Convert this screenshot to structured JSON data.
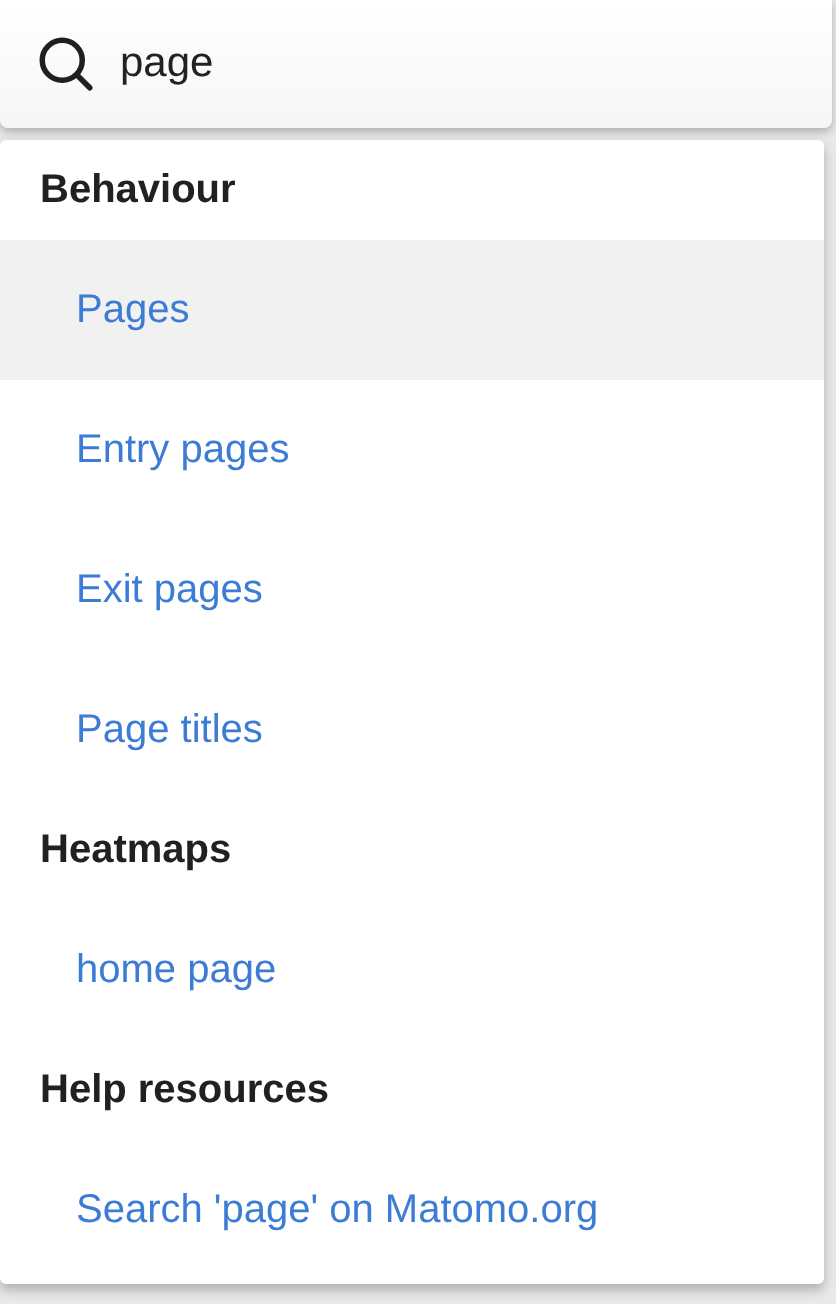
{
  "search": {
    "value": "page"
  },
  "groups": [
    {
      "heading": "Behaviour",
      "items": [
        {
          "label": "Pages",
          "selected": true
        },
        {
          "label": "Entry pages",
          "selected": false
        },
        {
          "label": "Exit pages",
          "selected": false
        },
        {
          "label": "Page titles",
          "selected": false
        }
      ]
    },
    {
      "heading": "Heatmaps",
      "items": [
        {
          "label": "home page",
          "selected": false
        }
      ]
    },
    {
      "heading": "Help resources",
      "items": [
        {
          "label": "Search 'page' on Matomo.org",
          "selected": false
        }
      ]
    }
  ]
}
